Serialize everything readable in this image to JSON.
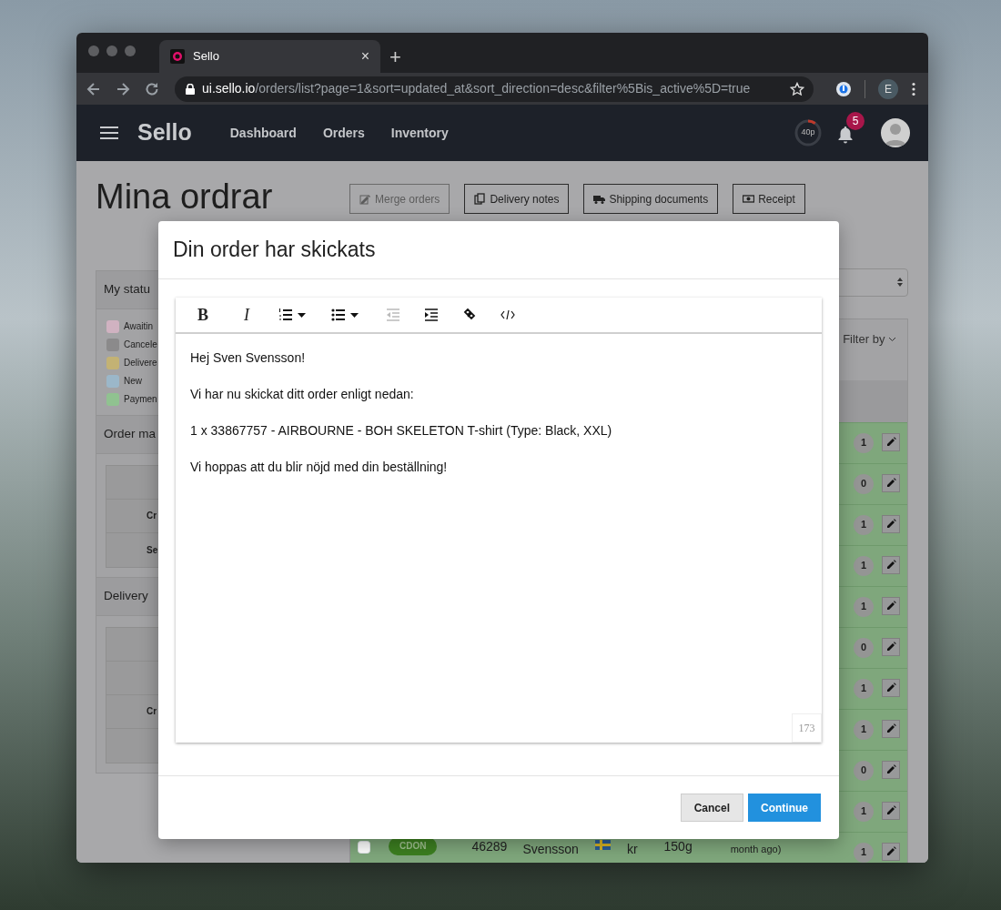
{
  "browser": {
    "tab": {
      "title": "Sello",
      "close": "×"
    },
    "new_tab": "+",
    "address": {
      "host": "ui.sello.io",
      "path": "/orders/list?page=1&sort=updated_at&sort_direction=desc&filter%5Bis_active%5D=true"
    },
    "profile": "E"
  },
  "navbar": {
    "logo": "Sello",
    "links": [
      "Dashboard",
      "Orders",
      "Inventory"
    ],
    "timer": {
      "label": "40p",
      "level": 0.1
    },
    "notifications": "5"
  },
  "page": {
    "title": "Mina ordrar",
    "actions": [
      {
        "label": "Merge orders",
        "disabled": true
      },
      {
        "label": "Delivery notes",
        "disabled": false
      },
      {
        "label": "Shipping documents",
        "disabled": false
      },
      {
        "label": "Receipt",
        "disabled": false
      }
    ]
  },
  "sidebar": {
    "status_panel": {
      "title": "My statu",
      "legend": [
        {
          "label": "Awaitin",
          "color": "#d0b2c1"
        },
        {
          "label": "Cancele",
          "color": "#8b8a8b"
        },
        {
          "label": "Delivere",
          "color": "#c3b274"
        },
        {
          "label": "New",
          "color": "#9bb7c9"
        },
        {
          "label": "Paymen",
          "color": "#90c290"
        }
      ]
    },
    "order_panel": {
      "title": "Order ma",
      "rows": [
        null,
        "Cr",
        "Se"
      ]
    },
    "delivery_panel": {
      "title": "Delivery",
      "rows": [
        null,
        null,
        "Cr",
        null
      ]
    }
  },
  "orders": {
    "filter_label": "Filter by",
    "rows": [
      {
        "count": "1"
      },
      {
        "count": "0"
      },
      {
        "count": "1"
      },
      {
        "count": "1"
      },
      {
        "count": "1"
      },
      {
        "count": "0"
      },
      {
        "count": "1"
      },
      {
        "count": "1"
      },
      {
        "count": "0"
      },
      {
        "count": "1"
      },
      {
        "count": "1",
        "checked": false,
        "channel": "CDON",
        "order_id": "46289",
        "customer": "Svensson",
        "price": "kr",
        "weight": "150g",
        "date": "month ago)"
      }
    ]
  },
  "modal": {
    "title": "Din order har skickats",
    "editor": {
      "toolbar": [
        {
          "kind": "bold",
          "label": "B",
          "dropdown": false,
          "disabled": false
        },
        {
          "kind": "italic",
          "label": "I",
          "dropdown": false,
          "disabled": false
        },
        {
          "kind": "ordered-list",
          "dropdown": true,
          "disabled": false
        },
        {
          "kind": "bullet-list",
          "dropdown": true,
          "disabled": false
        },
        {
          "kind": "outdent",
          "dropdown": false,
          "disabled": true
        },
        {
          "kind": "indent",
          "dropdown": false,
          "disabled": false
        },
        {
          "kind": "link",
          "dropdown": false,
          "disabled": false
        },
        {
          "kind": "code",
          "dropdown": false,
          "disabled": false
        }
      ],
      "paragraphs": [
        "Hej Sven Svensson!",
        "Vi har nu skickat ditt order enligt nedan:",
        "1 x 33867757 - AIRBOURNE - BOH SKELETON T-shirt (Type: Black, XXL)",
        "Vi hoppas att du blir nöjd med din beställning!"
      ],
      "char_count": "173"
    },
    "buttons": [
      {
        "label": "Cancel",
        "kind": "secondary"
      },
      {
        "label": "Continue",
        "kind": "primary"
      }
    ]
  }
}
